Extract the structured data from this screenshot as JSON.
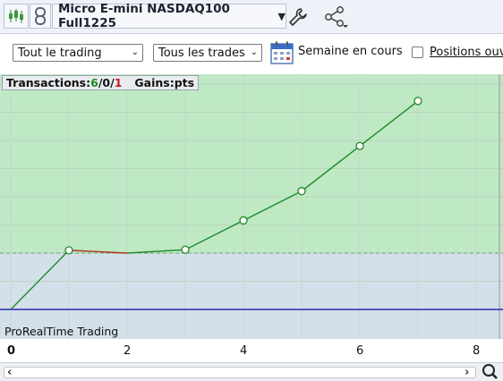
{
  "toolbar": {
    "instrument": "Micro E-mini NASDAQ100 Full1225",
    "icons": [
      "candlestick-icon",
      "link-icon",
      "chevron-down-icon",
      "wrench-icon",
      "share-icon"
    ]
  },
  "filters": {
    "trading_select": "Tout le trading",
    "trades_select": "Tous les trades",
    "period_label": "Semaine en cours",
    "positions_label": "Positions ouv",
    "positions_checked": false
  },
  "stats": {
    "label": "Transactions:",
    "wins": "6",
    "sep1": " / ",
    "neutral": "0",
    "sep2": " / ",
    "losses": "1",
    "gains_label": "Gains:",
    "gains_unit": "pts"
  },
  "watermark": "ProRealTime Trading",
  "chart_data": {
    "type": "line",
    "x": [
      0,
      1,
      2,
      3,
      4,
      5,
      6,
      7
    ],
    "y": [
      0,
      1.05,
      1.0,
      1.06,
      1.58,
      2.1,
      2.9,
      3.7
    ],
    "markers_at": [
      1,
      3,
      4,
      5,
      6,
      7
    ],
    "losing_segment": [
      1,
      2
    ],
    "xticks": [
      "0",
      "2",
      "4",
      "6",
      "8"
    ],
    "xlim": [
      0,
      8.4
    ],
    "ylim": [
      -0.5,
      4.1
    ],
    "baseline": 0,
    "dashed_level": 1.0,
    "grid": true,
    "colors": {
      "line": "#1f8a2a",
      "loss": "#b22a1a",
      "positive_zone": "#bfe8c4",
      "negative_zone": "#d3e0ea",
      "baseline": "#2a2ab8"
    }
  }
}
